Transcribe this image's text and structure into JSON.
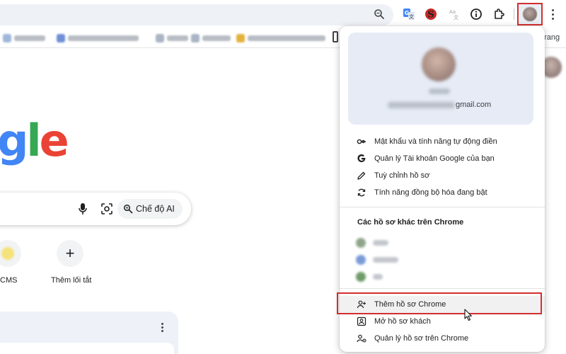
{
  "toolbar": {
    "zoom_icon": "zoom-icon",
    "extensions": [
      "translate-icon",
      "s-extension-icon",
      "language-extension-icon",
      "info-icon",
      "puzzle-icon"
    ],
    "avatar_icon": "profile-avatar-icon",
    "menu_icon": "more-vert-icon"
  },
  "bookmarks": {
    "visible_right_text": "trang"
  },
  "page": {
    "logo_partial": "gle",
    "ai_mode_label": "Chế độ AI",
    "shortcuts": [
      {
        "label": "CMS"
      },
      {
        "label": "Thêm lối tắt",
        "symbol": "+"
      }
    ]
  },
  "profile_menu": {
    "email_suffix": "gmail.com",
    "items": [
      {
        "label": "Mật khẩu và tính năng tự động điền",
        "icon": "key-icon"
      },
      {
        "label": "Quản lý Tài khoản Google của bạn",
        "icon": "google-g-icon"
      },
      {
        "label": "Tuỳ chỉnh hồ sơ",
        "icon": "pencil-icon"
      },
      {
        "label": "Tính năng đồng bộ hóa đang bật",
        "icon": "sync-icon"
      }
    ],
    "other_profiles_title": "Các hồ sơ khác trên Chrome",
    "bottom_items": [
      {
        "label": "Thêm hồ sơ Chrome",
        "icon": "add-person-icon"
      },
      {
        "label": "Mở hồ sơ khách",
        "icon": "guest-profile-icon"
      },
      {
        "label": "Quản lý hồ sơ trên Chrome",
        "icon": "manage-profiles-icon"
      }
    ]
  },
  "colors": {
    "highlight": "#d32f2f",
    "google_blue": "#4285F4",
    "google_red": "#EA4335",
    "google_yellow": "#FBBC05",
    "google_green": "#34A853",
    "menu_header_bg": "#e6ebf5"
  }
}
